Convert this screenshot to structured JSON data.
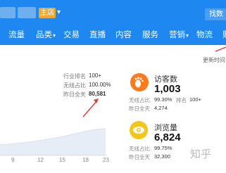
{
  "header": {
    "shop_badge": "主店",
    "search_label": "找数",
    "nav": [
      {
        "label": "流量",
        "caret": false
      },
      {
        "label": "品类",
        "caret": true
      },
      {
        "label": "交易",
        "caret": false
      },
      {
        "label": "直播",
        "caret": false
      },
      {
        "label": "内容",
        "caret": false
      },
      {
        "label": "服务",
        "caret": false
      },
      {
        "label": "营销",
        "caret": true
      },
      {
        "label": "物流",
        "caret": false
      },
      {
        "label": "财",
        "caret": false
      }
    ]
  },
  "update_time": "更新时间",
  "summary": {
    "rows": [
      {
        "label": "行业排名",
        "value": "100+"
      },
      {
        "label": "无线占比",
        "value": "100.00%"
      },
      {
        "label": "昨日全天",
        "value": "80,581"
      }
    ]
  },
  "chart_data": {
    "type": "area",
    "x": [
      "9",
      "12",
      "15",
      "18",
      "23"
    ],
    "tick_labels": [
      "9",
      "12",
      "15",
      "18",
      "23"
    ],
    "color": "#e8eef6",
    "grid": false
  },
  "cards": [
    {
      "title": "访客数",
      "value": "1,003",
      "icon": "footprint-icon",
      "icon_color": "#ff7a1a",
      "rows": [
        {
          "label": "无线占比",
          "value": "99.30%",
          "label2": "排名",
          "value2": "100+"
        },
        {
          "label": "昨日全天",
          "value": "4,274"
        }
      ]
    },
    {
      "title": "浏览量",
      "value": "6,824",
      "icon": "eye-icon",
      "icon_color": "#f5c518",
      "rows": [
        {
          "label": "无线占比",
          "value": "99.75%"
        },
        {
          "label": "昨日全天",
          "value": "32,300"
        }
      ]
    }
  ],
  "watermark": "知乎"
}
